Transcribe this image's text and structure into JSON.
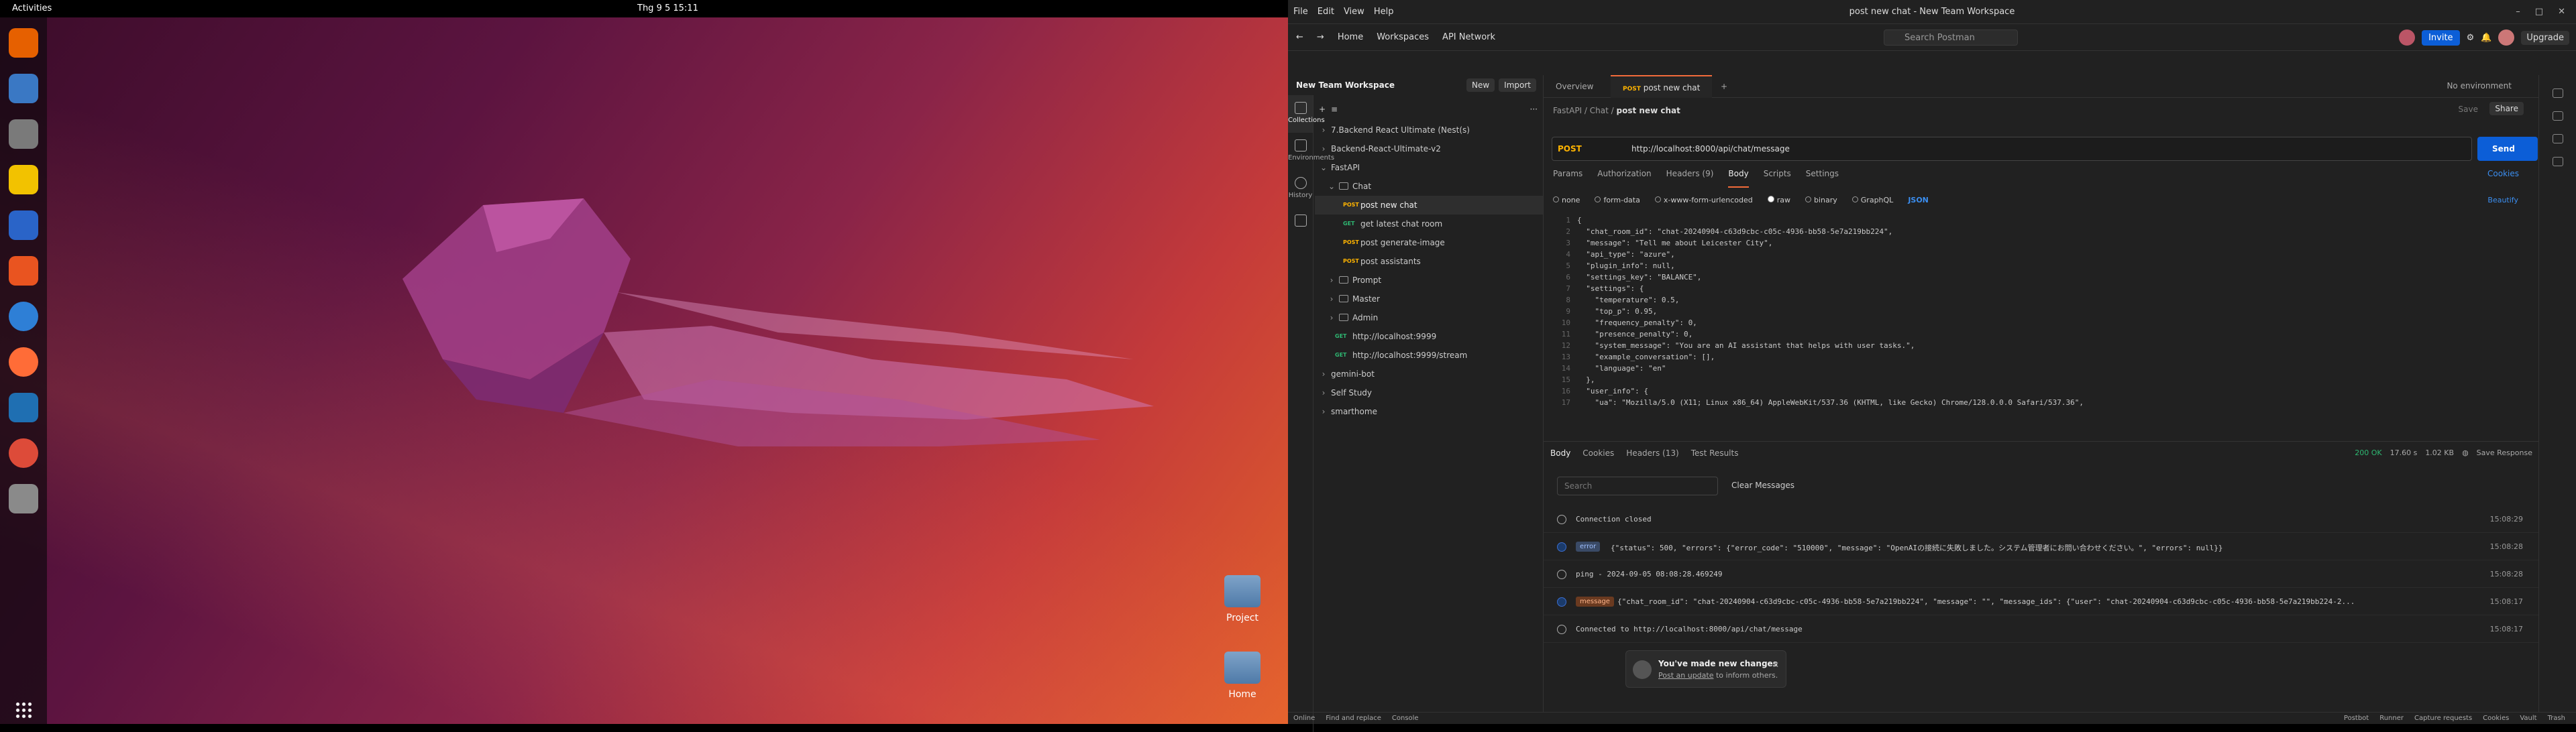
{
  "topbar": {
    "activities": "Activities",
    "clock": "Thg 9 5  15:11"
  },
  "desktop": {
    "icons": [
      {
        "label": "Project"
      },
      {
        "label": "Home"
      }
    ]
  },
  "postman": {
    "window_title": "post new chat - New Team Workspace",
    "menu": [
      "File",
      "Edit",
      "View",
      "Help"
    ],
    "header": {
      "home": "Home",
      "workspaces": "Workspaces",
      "api_network": "API Network",
      "search_placeholder": "Search Postman",
      "invite": "Invite",
      "upgrade": "Upgrade"
    },
    "rail": [
      "Collections",
      "Environments",
      "History"
    ],
    "workspace": {
      "name": "New Team Workspace",
      "new": "New",
      "import": "Import"
    },
    "tree": [
      "7.Backend React Ultimate (Nest(s)",
      "Backend-React-Ultimate-v2",
      "FastAPI",
      "Chat",
      "post new chat",
      "get latest chat room",
      "post generate-image",
      "post assistants",
      "Prompt",
      "Master",
      "Admin",
      "http://localhost:9999",
      "http://localhost:9999/stream",
      "gemini-bot",
      "Self Study",
      "smarthome"
    ],
    "tree_methods": {
      "post": "POST",
      "get": "GET"
    },
    "tabs": {
      "overview": "Overview",
      "active_method": "POST",
      "active": "post new chat",
      "env": "No environment"
    },
    "breadcrumb": {
      "a": "FastAPI",
      "b": "Chat",
      "c": "post new chat",
      "save": "Save",
      "share": "Share"
    },
    "request": {
      "method": "POST",
      "url": "http://localhost:8000/api/chat/message",
      "send": "Send"
    },
    "subtabs": [
      "Params",
      "Authorization",
      "Headers (9)",
      "Body",
      "Scripts",
      "Settings"
    ],
    "cookies": "Cookies",
    "beautify": "Beautify",
    "body_types": [
      "none",
      "form-data",
      "x-www-form-urlencoded",
      "raw",
      "binary",
      "GraphQL",
      "JSON"
    ],
    "code_lines": [
      "{",
      "  \"chat_room_id\": \"chat-20240904-c63d9cbc-c05c-4936-bb58-5e7a219bb224\",",
      "  \"message\": \"Tell me about Leicester City\",",
      "  \"api_type\": \"azure\",",
      "  \"plugin_info\": null,",
      "  \"settings_key\": \"BALANCE\",",
      "  \"settings\": {",
      "    \"temperature\": 0.5,",
      "    \"top_p\": 0.95,",
      "    \"frequency_penalty\": 0,",
      "    \"presence_penalty\": 0,",
      "    \"system_message\": \"You are an AI assistant that helps with user tasks.\",",
      "    \"example_conversation\": [],",
      "    \"language\": \"en\"",
      "  },",
      "  \"user_info\": {",
      "    \"ua\": \"Mozilla/5.0 (X11; Linux x86_64) AppleWebKit/537.36 (KHTML, like Gecko) Chrome/128.0.0.0 Safari/537.36\","
    ],
    "response": {
      "tabs": [
        "Body",
        "Cookies",
        "Headers (13)",
        "Test Results"
      ],
      "status": "200 OK",
      "time": "17.60 s",
      "size": "1.02 KB",
      "save": "Save Response",
      "search_placeholder": "Search",
      "clear": "Clear Messages",
      "messages": [
        {
          "badge": "",
          "text": "Connection closed",
          "time": "15:08:29"
        },
        {
          "badge": "error",
          "text": "{\"status\": 500, \"errors\": {\"error_code\": \"510000\", \"message\": \"OpenAIの接続に失敗しました。システム管理者にお問い合わせください。\", \"errors\": null}}",
          "time": "15:08:28"
        },
        {
          "badge": "",
          "text": "ping - 2024-09-05 08:08:28.469249",
          "time": "15:08:28"
        },
        {
          "badge": "message",
          "text": "{\"chat_room_id\": \"chat-20240904-c63d9cbc-c05c-4936-bb58-5e7a219bb224\", \"message\": \"\", \"message_ids\": {\"user\": \"chat-20240904-c63d9cbc-c05c-4936-bb58-5e7a219bb224-2...",
          "time": "15:08:17"
        },
        {
          "badge": "",
          "text": "Connected to http://localhost:8000/api/chat/message",
          "time": "15:08:17"
        }
      ]
    },
    "toast": {
      "title": "You've made new changes",
      "link": "Post an update",
      "rest": " to inform others."
    },
    "statusbar": {
      "left": [
        "Online",
        "Find and replace",
        "Console"
      ],
      "right": [
        "Postbot",
        "Runner",
        "Capture requests",
        "Cookies",
        "Vault",
        "Trash"
      ]
    }
  }
}
